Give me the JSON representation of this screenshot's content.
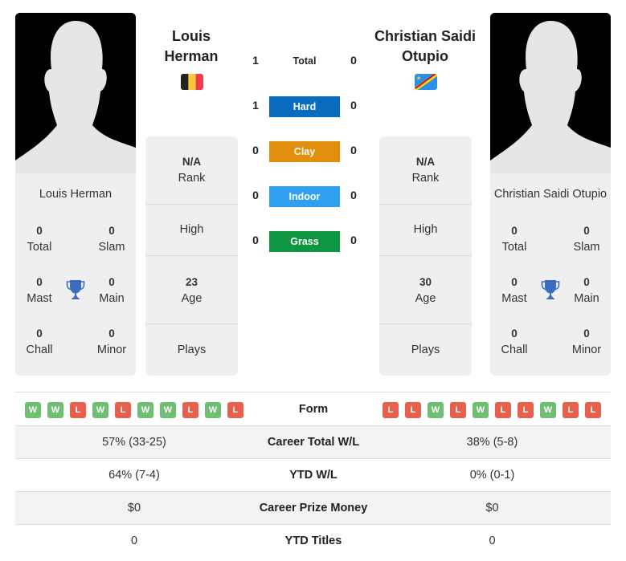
{
  "colors": {
    "hard": "#0b6cbf",
    "clay": "#e08e0b",
    "indoor": "#2f9ff0",
    "grass": "#0f9640",
    "win": "#6fbf73",
    "loss": "#e8604c",
    "trophy": "#3a6cc0"
  },
  "player1": {
    "name": "Louis Herman",
    "header_name_line1": "Louis",
    "header_name_line2": "Herman",
    "flag": "belgium-flag",
    "titles": {
      "total": {
        "value": "0",
        "label": "Total"
      },
      "slam": {
        "value": "0",
        "label": "Slam"
      },
      "mast": {
        "value": "0",
        "label": "Mast"
      },
      "main": {
        "value": "0",
        "label": "Main"
      },
      "chall": {
        "value": "0",
        "label": "Chall"
      },
      "minor": {
        "value": "0",
        "label": "Minor"
      }
    },
    "rank": {
      "value": "N/A",
      "label": "Rank"
    },
    "high": {
      "label": "High"
    },
    "age": {
      "value": "23",
      "label": "Age"
    },
    "plays": {
      "label": "Plays"
    },
    "form": [
      "W",
      "W",
      "L",
      "W",
      "L",
      "W",
      "W",
      "L",
      "W",
      "L"
    ],
    "career_total_wl": "57% (33-25)",
    "ytd_wl": "64% (7-4)",
    "career_prize_money": "$0",
    "ytd_titles": "0"
  },
  "player2": {
    "name": "Christian Saidi Otupio",
    "header_name_line1": "Christian Saidi",
    "header_name_line2": "Otupio",
    "flag": "dr-congo-flag",
    "titles": {
      "total": {
        "value": "0",
        "label": "Total"
      },
      "slam": {
        "value": "0",
        "label": "Slam"
      },
      "mast": {
        "value": "0",
        "label": "Mast"
      },
      "main": {
        "value": "0",
        "label": "Main"
      },
      "chall": {
        "value": "0",
        "label": "Chall"
      },
      "minor": {
        "value": "0",
        "label": "Minor"
      }
    },
    "rank": {
      "value": "N/A",
      "label": "Rank"
    },
    "high": {
      "label": "High"
    },
    "age": {
      "value": "30",
      "label": "Age"
    },
    "plays": {
      "label": "Plays"
    },
    "form": [
      "L",
      "L",
      "W",
      "L",
      "W",
      "L",
      "L",
      "W",
      "L",
      "L"
    ],
    "career_total_wl": "38% (5-8)",
    "ytd_wl": "0% (0-1)",
    "career_prize_money": "$0",
    "ytd_titles": "0"
  },
  "h2h": {
    "total": {
      "label": "Total",
      "p1": "1",
      "p2": "0"
    },
    "hard": {
      "label": "Hard",
      "p1": "1",
      "p2": "0"
    },
    "clay": {
      "label": "Clay",
      "p1": "0",
      "p2": "0"
    },
    "indoor": {
      "label": "Indoor",
      "p1": "0",
      "p2": "0"
    },
    "grass": {
      "label": "Grass",
      "p1": "0",
      "p2": "0"
    }
  },
  "table_labels": {
    "form": "Form",
    "career_total_wl": "Career Total W/L",
    "ytd_wl": "YTD W/L",
    "career_prize_money": "Career Prize Money",
    "ytd_titles": "YTD Titles"
  }
}
